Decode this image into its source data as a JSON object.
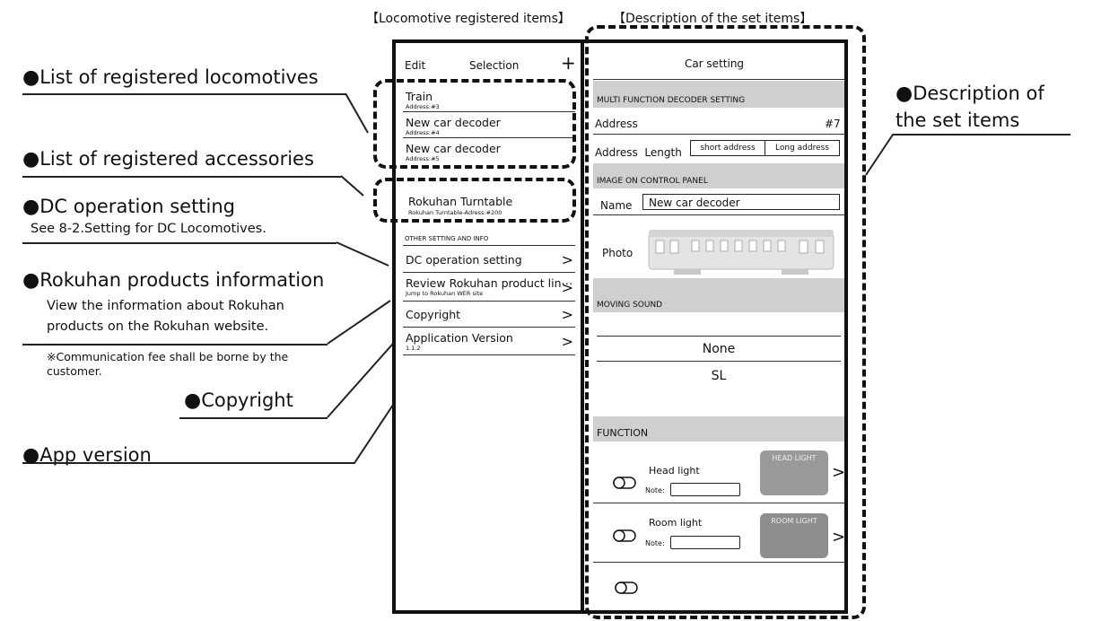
{
  "headers": {
    "locomotive_items": "【Locomotive registered items】",
    "description_items": "【Description of the set items】"
  },
  "callouts": {
    "registered_locomotives": "List of registered locomotives",
    "registered_accessories": "List of registered accessories",
    "dc_operation": "DC operation setting",
    "dc_operation_sub": "See 8-2.Setting for DC Locomotives.",
    "rokuhan_info": "Rokuhan products information",
    "rokuhan_info_sub1": "View the information about Rokuhan",
    "rokuhan_info_sub2": "products on the Rokuhan website.",
    "rokuhan_note": "※Communication fee shall be borne by the customer.",
    "copyright": "Copyright",
    "app_version": "App version",
    "description_of": "Description of",
    "the_set_items": "the set items",
    "bullet": "●"
  },
  "left_panel": {
    "edit": "Edit",
    "selection": "Selection",
    "plus": "+",
    "locomotives": [
      {
        "name": "Train",
        "address": "Address:#3"
      },
      {
        "name": "New car decoder",
        "address": "Address:#4"
      },
      {
        "name": "New car decoder",
        "address": "Address:#5"
      }
    ],
    "accessory": {
      "name": "Rokuhan Turntable",
      "address": "Rokuhan Turntable-Adress:#200"
    },
    "section_label": "OTHER SETTING AND INFO",
    "menu": [
      {
        "label": "DC operation setting",
        "sub": ""
      },
      {
        "label": "Review Rokuhan product lin⋯",
        "sub": "Jump to Rokuhan WER site"
      },
      {
        "label": "Copyright",
        "sub": ""
      },
      {
        "label": "Application Version",
        "sub": "1.1.2"
      }
    ],
    "chevron": ">"
  },
  "right_panel": {
    "title": "Car setting",
    "decoder_section": "MULTI FUNCTION DECODER SETTING",
    "address_label": "Address",
    "address_value": "#7",
    "address_length_label": "Address  Length",
    "short_address": "short address",
    "long_address": "Long address",
    "image_section": "IMAGE ON CONTROL PANEL",
    "name_label": "Name",
    "name_value": "New car decoder",
    "photo_label": "Photo",
    "moving_sound_section": "MOVING SOUND",
    "sound_options": [
      "None",
      "SL"
    ],
    "function_section": "FUNCTION",
    "functions": [
      {
        "label": "Head light",
        "note_label": "Note:",
        "badge": "HEAD LIGHT"
      },
      {
        "label": "Room light",
        "note_label": "Note:",
        "badge": "ROOM LIGHT"
      }
    ],
    "chevron": ">"
  }
}
